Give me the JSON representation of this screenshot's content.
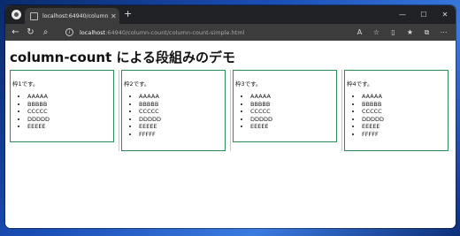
{
  "browser": {
    "tab_title": "localhost:64940/column-count/col",
    "url_host": "localhost",
    "url_path": ":64940/column-count/column-count-simple.html"
  },
  "page": {
    "heading": "column-count による段組みのデモ",
    "frames": [
      {
        "label": "枠1です。",
        "items": [
          "AAAAA",
          "BBBBB",
          "CCCCC",
          "DDDDD",
          "EEEEE"
        ]
      },
      {
        "label": "枠2です。",
        "items": [
          "AAAAA",
          "BBBBB",
          "CCCCC",
          "DDDDD",
          "EEEEE",
          "FFFFF"
        ]
      },
      {
        "label": "枠3です。",
        "items": [
          "AAAAA",
          "BBBBB",
          "CCCCC",
          "DDDDD",
          "EEEEE"
        ]
      },
      {
        "label": "枠4です。",
        "items": [
          "AAAAA",
          "BBBBB",
          "CCCCC",
          "DDDDD",
          "EEEEE",
          "FFFFF"
        ]
      }
    ]
  },
  "colors": {
    "frame_border": "#2e8b57"
  }
}
